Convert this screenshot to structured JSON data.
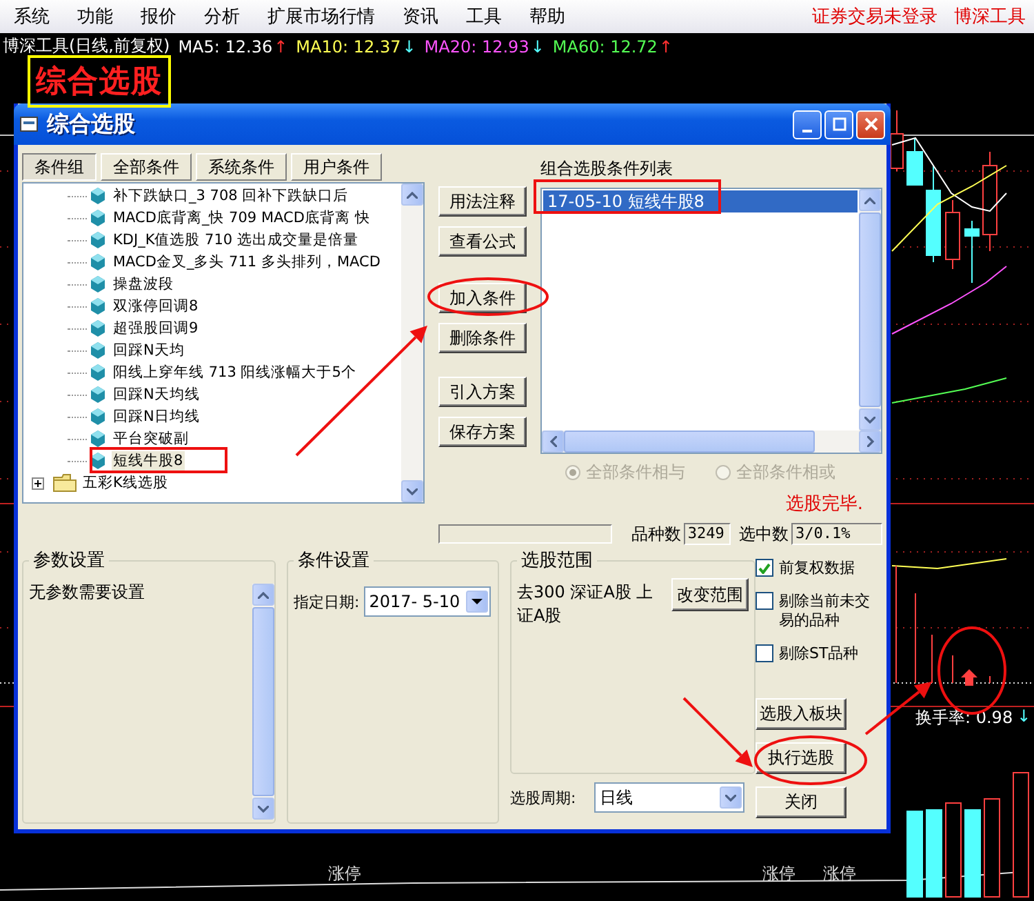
{
  "menu": {
    "items": [
      "系统",
      "功能",
      "报价",
      "分析",
      "扩展市场行情",
      "资讯",
      "工具",
      "帮助"
    ],
    "status": "证券交易未登录",
    "stock": "博深工具"
  },
  "info_bar": {
    "title": "博深工具(日线,前复权)",
    "indicators": [
      {
        "label": "MA5:",
        "value": "12.36",
        "color": "#ffffff",
        "arrow": {
          "text": "↑",
          "color": "#ff3030"
        }
      },
      {
        "label": "MA10:",
        "value": "12.37",
        "color": "#ffff54",
        "arrow": {
          "text": "↓",
          "color": "#54ffff"
        }
      },
      {
        "label": "MA20:",
        "value": "12.93",
        "color": "#ff54ff",
        "arrow": {
          "text": "↓",
          "color": "#54ffff"
        }
      },
      {
        "label": "MA60:",
        "value": "12.72",
        "color": "#54ff54",
        "arrow": {
          "text": "↑",
          "color": "#ff3030"
        }
      }
    ]
  },
  "chart": {
    "turnover": "换手率: 0.98",
    "turnover_arrow": "↓",
    "bottom_labels": [
      "涨停",
      "涨停",
      "涨停"
    ]
  },
  "annotation_label": "综合选股",
  "dialog": {
    "title": "综合选股",
    "tabs": [
      {
        "label": "条件组",
        "selected": true
      },
      {
        "label": "全部条件",
        "selected": false
      },
      {
        "label": "系统条件",
        "selected": false
      },
      {
        "label": "用户条件",
        "selected": false
      }
    ],
    "tree": [
      {
        "kind": "group",
        "children": [
          {
            "kind": "leaf",
            "label": "补下跌缺口_3 708 回补下跌缺口后",
            "selected": false
          },
          {
            "kind": "leaf",
            "label": "MACD底背离_快 709 MACD底背离 快",
            "selected": false
          },
          {
            "kind": "leaf",
            "label": "KDJ_K值选股 710 选出成交量是倍量",
            "selected": false
          },
          {
            "kind": "leaf",
            "label": "MACD金叉_多头 711 多头排列，MACD",
            "selected": false
          },
          {
            "kind": "leaf",
            "label": "操盘波段",
            "selected": false
          },
          {
            "kind": "leaf",
            "label": "双涨停回调8",
            "selected": false
          },
          {
            "kind": "leaf",
            "label": "超强股回调9",
            "selected": false
          },
          {
            "kind": "leaf",
            "label": "回踩N天均",
            "selected": false
          },
          {
            "kind": "leaf",
            "label": "阳线上穿年线 713 阳线涨幅大于5个",
            "selected": false
          },
          {
            "kind": "leaf",
            "label": "回踩N天均线",
            "selected": false
          },
          {
            "kind": "leaf",
            "label": "回踩N日均线",
            "selected": false
          },
          {
            "kind": "leaf",
            "label": "平台突破副",
            "selected": false
          },
          {
            "kind": "leaf",
            "label": "短线牛股8",
            "selected": true
          }
        ]
      },
      {
        "kind": "folder",
        "label": "五彩K线选股",
        "expanded": false
      }
    ],
    "buttons": [
      "用法注释",
      "查看公式",
      "加入条件",
      "删除条件",
      "引入方案",
      "保存方案"
    ],
    "conditions_list": {
      "label": "组合选股条件列表",
      "items": [
        {
          "label": "17-05-10 短线牛股8",
          "selected": true
        }
      ]
    },
    "logic": [
      {
        "label": "全部条件相与",
        "selected": true,
        "disabled": true
      },
      {
        "label": "全部条件相或",
        "selected": false,
        "disabled": true
      }
    ],
    "status": "选股完毕.",
    "progress": {
      "level": 0
    },
    "stats": [
      {
        "label": "品种数",
        "value": "3249"
      },
      {
        "label": "选中数",
        "value": "3/0.1%"
      }
    ],
    "params": {
      "title": "参数设置",
      "text": "无参数需要设置"
    },
    "condition_settings": {
      "title": "条件设置",
      "date_label": "指定日期:",
      "date": "2017- 5-10"
    },
    "range": {
      "title": "选股范围",
      "text": "去300 深证A股 上证A股",
      "button": "改变范围"
    },
    "period": {
      "label": "选股周期:",
      "value": "日线"
    },
    "options": [
      {
        "label": "前复权数据",
        "checked": true
      },
      {
        "label": "剔除当前未交易的品种",
        "checked": false
      },
      {
        "label": "剔除ST品种",
        "checked": false
      }
    ],
    "actions": [
      "选股入板块",
      "执行选股",
      "关闭"
    ]
  }
}
